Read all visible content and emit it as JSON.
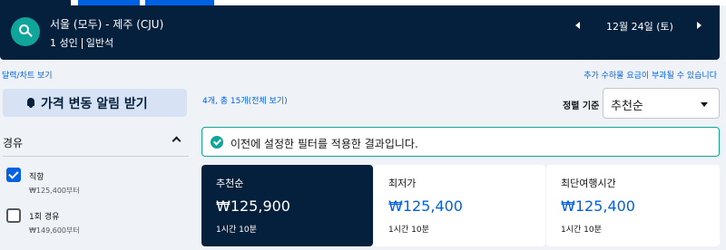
{
  "header": {
    "route": "서울 (모두) - 제주 (CJU)",
    "passengers": "1 성인",
    "cabin": "일반석",
    "date": "12월 24일 (토)"
  },
  "links": {
    "chart": "달력/차트 보기",
    "fees": "추가 수하물 요금이 부과될 수 있습니다"
  },
  "price_alert": {
    "label": "가격 변동 알림 받기"
  },
  "results": {
    "count": "4개, 총 15개(전체 보기)",
    "sort_label": "정렬 기준",
    "sort_value": "추천순"
  },
  "filters": {
    "stops_title": "경유",
    "options": [
      {
        "name": "직항",
        "price": "₩125,400부터",
        "checked": true
      },
      {
        "name": "1회 경유",
        "price": "₩149,600부터",
        "checked": false
      }
    ]
  },
  "notice": {
    "message": "이전에 설정한 필터를 적용한 결과입니다."
  },
  "sort_tabs": [
    {
      "name": "추천순",
      "price": "₩125,900",
      "duration": "1시간 10분",
      "active": true
    },
    {
      "name": "최저가",
      "price": "₩125,400",
      "duration": "1시간 10분",
      "active": false
    },
    {
      "name": "최단여행시간",
      "price": "₩125,400",
      "duration": "1시간 10분",
      "active": false
    }
  ],
  "colors": {
    "navy": "#05203c",
    "brand_blue": "#0062e3",
    "teal": "#0fa59a",
    "background": "#eff3f8"
  }
}
